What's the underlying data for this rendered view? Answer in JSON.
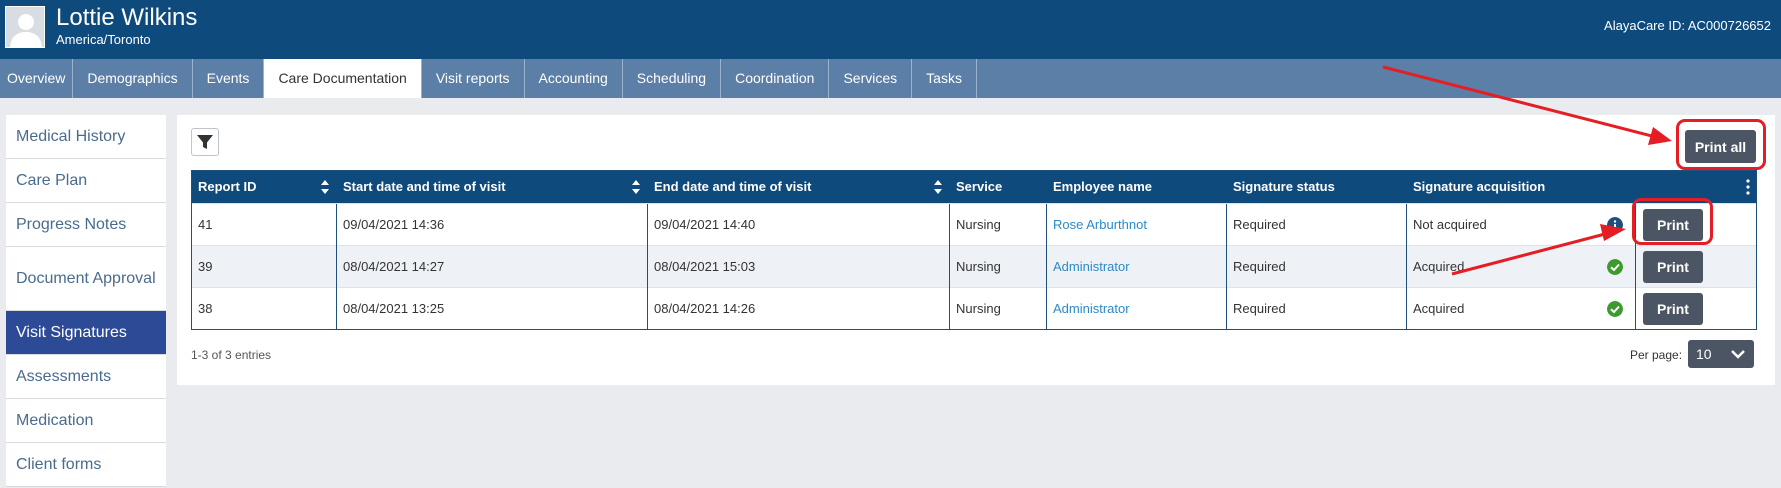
{
  "header": {
    "client_name": "Lottie Wilkins",
    "timezone": "America/Toronto",
    "alayacare_id": "AlayaCare ID: AC000726652",
    "bg_color": "#0f4a7d"
  },
  "tabs": [
    {
      "label": "Overview",
      "active": false
    },
    {
      "label": "Demographics",
      "active": false
    },
    {
      "label": "Events",
      "active": false
    },
    {
      "label": "Care Documentation",
      "active": true
    },
    {
      "label": "Visit reports",
      "active": false
    },
    {
      "label": "Accounting",
      "active": false
    },
    {
      "label": "Scheduling",
      "active": false
    },
    {
      "label": "Coordination",
      "active": false
    },
    {
      "label": "Services",
      "active": false
    },
    {
      "label": "Tasks",
      "active": false
    }
  ],
  "sidebar": {
    "items": [
      {
        "label": "Medical History",
        "active": false
      },
      {
        "label": "Care Plan",
        "active": false
      },
      {
        "label": "Progress Notes",
        "active": false
      },
      {
        "label": "Document Approval",
        "active": false
      },
      {
        "label": "Visit Signatures",
        "active": true
      },
      {
        "label": "Assessments",
        "active": false
      },
      {
        "label": "Medication",
        "active": false
      },
      {
        "label": "Client forms",
        "active": false
      }
    ],
    "active_color": "#2c4a96"
  },
  "toolbar": {
    "filter_icon": "filter-icon",
    "print_all_label": "Print all"
  },
  "table": {
    "columns": [
      "Report ID",
      "Start date and time of visit",
      "End date and time of visit",
      "Service",
      "Employee name",
      "Signature status",
      "Signature acquisition"
    ],
    "rows": [
      {
        "report_id": "41",
        "start": "09/04/2021 14:36",
        "end": "09/04/2021 14:40",
        "service": "Nursing",
        "employee": "Rose Arburthnot",
        "signature_status": "Required",
        "acquisition": "Not acquired",
        "acquisition_icon": "info-icon",
        "print_label": "Print"
      },
      {
        "report_id": "39",
        "start": "08/04/2021 14:27",
        "end": "08/04/2021 15:03",
        "service": "Nursing",
        "employee": "Administrator",
        "signature_status": "Required",
        "acquisition": "Acquired",
        "acquisition_icon": "check-circle-icon",
        "print_label": "Print"
      },
      {
        "report_id": "38",
        "start": "08/04/2021 13:25",
        "end": "08/04/2021 14:26",
        "service": "Nursing",
        "employee": "Administrator",
        "signature_status": "Required",
        "acquisition": "Acquired",
        "acquisition_icon": "check-circle-icon",
        "print_label": "Print"
      }
    ]
  },
  "footer": {
    "entries": "1-3 of 3 entries",
    "per_page_label": "Per page:",
    "per_page_value": "10"
  },
  "colors": {
    "annotation_red": "#e51e25",
    "check_green": "#3c9a2e",
    "info_blue": "#1f4f7c",
    "link_blue": "#2d8ac6"
  }
}
